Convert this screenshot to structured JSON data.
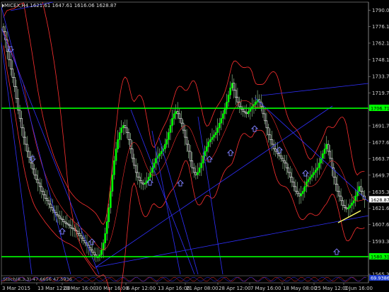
{
  "chart_title": "MICEX,H4",
  "ohlc": "1621.61 1647.61 1616.06 1628.87",
  "indicator_label": "Stoch(8,3,3) 47.6656 47.5936",
  "price_ticks": [
    "1790.00",
    "1776.10",
    "1762.10",
    "1748.10",
    "1733.70",
    "1719.70",
    "1705.71",
    "1691.70",
    "1677.60",
    "1663.70",
    "1649.70",
    "1635.30",
    "1621.61",
    "1607.60",
    "1593.30",
    "1580.31",
    "1565.30"
  ],
  "x_labels": [
    "3 Mar 2015",
    "13 Mar 12:00",
    "20 Mar 16:00",
    "30 Mar 16:00",
    "6 Apr 12:00",
    "13 Apr 16:00",
    "21 Apr 08:00",
    "28 Apr 12:00",
    "7 May 16:00",
    "18 May 08:00",
    "25 May 12:00",
    "1 Jun 16:00"
  ],
  "current_price_label": "1628.87",
  "green_level_upper_label": "1706.71",
  "green_level_lower_label": "1580.31",
  "indicator_value_label": "69.9386",
  "colors": {
    "background": "#000000",
    "bull_candle": "#00ff00",
    "bear_candle": "#ffffff",
    "bollinger": "#ff3030",
    "trendline": "#3030ff",
    "level": "#00ff00",
    "arrow": "#7f7fff",
    "accent_yellow": "#ffff66"
  },
  "chart_data": {
    "type": "candlestick",
    "title": "MICEX,H4",
    "ylim": [
      1565.3,
      1797
    ],
    "x_tick_labels": [
      "3 Mar 2015",
      "13 Mar 12:00",
      "20 Mar 16:00",
      "30 Mar 16:00",
      "6 Apr 12:00",
      "13 Apr 16:00",
      "21 Apr 08:00",
      "28 Apr 12:00",
      "7 May 16:00",
      "18 May 08:00",
      "25 May 12:00",
      "1 Jun 16:00"
    ],
    "horizontal_levels": [
      1706.71,
      1580.31
    ],
    "last_price": 1628.87,
    "close_path": [
      1772,
      1765,
      1755,
      1748,
      1740,
      1733,
      1725,
      1715,
      1705,
      1698,
      1690,
      1682,
      1676,
      1670,
      1665,
      1660,
      1655,
      1650,
      1646,
      1643,
      1640,
      1636,
      1633,
      1630,
      1628,
      1625,
      1622,
      1620,
      1618,
      1616,
      1615,
      1613,
      1612,
      1610,
      1609,
      1608,
      1607,
      1605,
      1604,
      1603,
      1602,
      1600,
      1598,
      1596,
      1594,
      1592,
      1590,
      1588,
      1586,
      1584,
      1582,
      1580,
      1580,
      1582,
      1586,
      1592,
      1600,
      1610,
      1622,
      1636,
      1650,
      1662,
      1672,
      1680,
      1686,
      1690,
      1692,
      1690,
      1686,
      1680,
      1672,
      1664,
      1658,
      1652,
      1648,
      1645,
      1643,
      1642,
      1643,
      1645,
      1648,
      1652,
      1656,
      1660,
      1664,
      1666,
      1668,
      1670,
      1672,
      1676,
      1680,
      1686,
      1692,
      1698,
      1702,
      1704,
      1702,
      1698,
      1694,
      1688,
      1682,
      1676,
      1670,
      1662,
      1656,
      1652,
      1650,
      1652,
      1656,
      1660,
      1666,
      1670,
      1674,
      1678,
      1680,
      1682,
      1684,
      1686,
      1690,
      1694,
      1698,
      1702,
      1706,
      1712,
      1718,
      1724,
      1728,
      1722,
      1716,
      1712,
      1708,
      1706,
      1704,
      1703,
      1702,
      1704,
      1706,
      1708,
      1710,
      1712,
      1714,
      1712,
      1708,
      1702,
      1696,
      1690,
      1684,
      1680,
      1676,
      1672,
      1670,
      1668,
      1666,
      1664,
      1662,
      1660,
      1656,
      1652,
      1648,
      1644,
      1640,
      1636,
      1634,
      1632,
      1634,
      1636,
      1640,
      1644,
      1646,
      1648,
      1650,
      1652,
      1654,
      1656,
      1660,
      1664,
      1668,
      1672,
      1676,
      1670,
      1664,
      1656,
      1648,
      1642,
      1636,
      1632,
      1628,
      1624,
      1622,
      1621,
      1622,
      1624,
      1626,
      1628,
      1632,
      1636,
      1640,
      1636,
      1632,
      1628.87
    ],
    "indicator": {
      "name": "Stoch(8,3,3)",
      "main": 47.6656,
      "signal": 47.5936
    }
  }
}
